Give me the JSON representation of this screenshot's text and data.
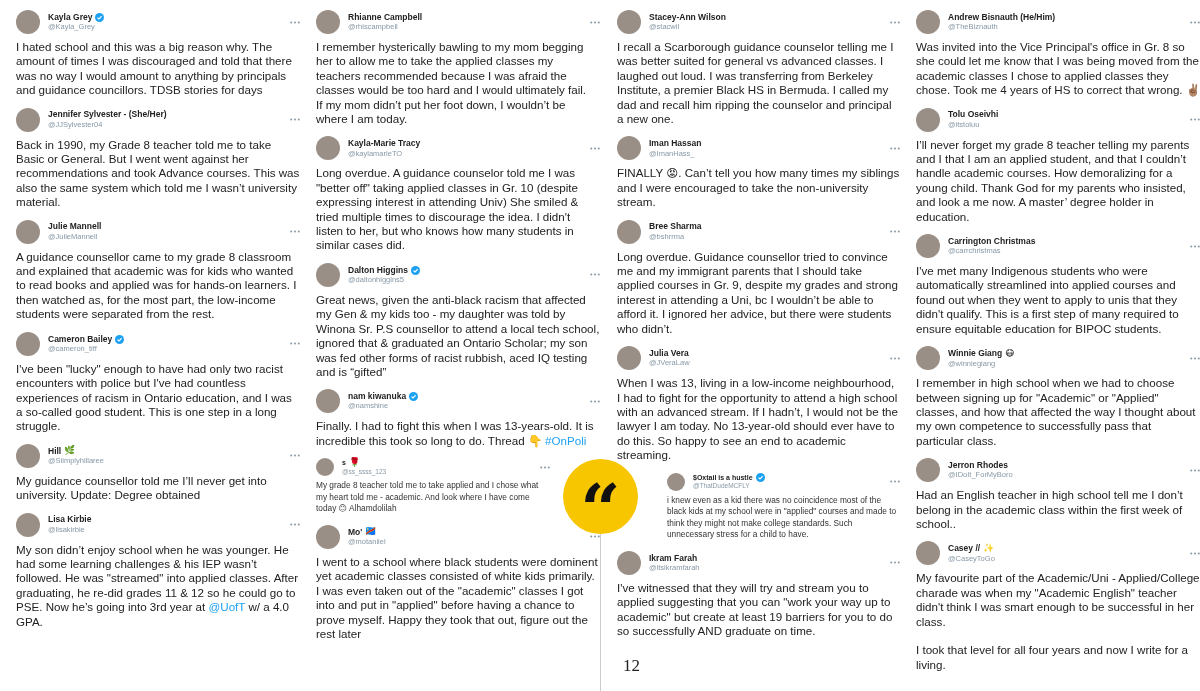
{
  "columns": [
    {
      "tweets": [
        {
          "name": "Kayla Grey",
          "verified": true,
          "handle": "@Kayla_Grey",
          "compact": false,
          "body": [
            {
              "kind": "text",
              "text": "I hated school and this was a big reason why. The amount of times I was  discouraged and told that there was no way I would amount to anything by principals and guidance councillors. TDSB stories for days"
            }
          ]
        },
        {
          "name": "Jennifer Sylvester - (She/Her)",
          "verified": false,
          "handle": "@JJSylvester04",
          "compact": false,
          "body": [
            {
              "kind": "text",
              "text": "Back in 1990, my Grade 8 teacher told me to take Basic or General. But I went went against her recommendations and took Advance courses. This was also the same system which told me I wasn’t university material."
            }
          ]
        },
        {
          "name": "Julie Mannell",
          "verified": false,
          "handle": "@JulieMannell",
          "compact": false,
          "body": [
            {
              "kind": "text",
              "text": "A guidance counsellor came to my grade 8 classroom and explained that academic was for kids who wanted to read books and applied was for hands-on learners. I then watched as, for the most part, the low-income students were separated from the rest."
            }
          ]
        },
        {
          "name": "Cameron Bailey",
          "verified": true,
          "handle": "@cameron_tiff",
          "compact": false,
          "body": [
            {
              "kind": "text",
              "text": "I've been \"lucky\" enough to have had only two racist encounters with police but I've had countless experiences of racism in Ontario education, and I was a so-called good student. This is one step in a long struggle."
            }
          ]
        },
        {
          "name": "Hill",
          "name_emoji": "🌿",
          "verified": false,
          "handle": "@Siimplyhillaree",
          "compact": false,
          "body": [
            {
              "kind": "text",
              "text": "My guidance counsellor told me I’ll never get into university. Update: Degree obtained"
            }
          ]
        },
        {
          "name": "Lisa Kirbie",
          "verified": false,
          "handle": "@lisakirbie",
          "compact": false,
          "body": [
            {
              "kind": "text",
              "text": "My son didn’t enjoy school when he was younger. He had some learning challenges & his IEP wasn’t followed. He was \"streamed\" into applied classes. After graduating, he re-did grades 11 & 12 so he could go to PSE. Now he’s going into 3rd year at "
            },
            {
              "kind": "link",
              "text": "@UofT"
            },
            {
              "kind": "text",
              "text": " w/ a 4.0 GPA."
            }
          ]
        }
      ]
    },
    {
      "tweets": [
        {
          "name": "Rhianne Campbell",
          "verified": false,
          "handle": "@rhiscampbell",
          "compact": false,
          "body": [
            {
              "kind": "text",
              "text": "I remember hysterically bawling to my mom begging her to allow me to take the applied classes my teachers recommended because I was afraid the classes would be too hard and I would ultimately fail.\nIf my mom didn’t put her foot down, I wouldn’t be where I am today."
            }
          ]
        },
        {
          "name": "Kayla-Marie Tracy",
          "verified": false,
          "handle": "@kaylamarieTO",
          "compact": false,
          "body": [
            {
              "kind": "text",
              "text": "Long overdue. A guidance counselor told me I was \"better off\" taking applied classes in Gr. 10 (despite expressing interest in attending Univ) She smiled & tried multiple times to discourage the idea. I didn't listen to her, but who knows how many students in similar cases did."
            }
          ]
        },
        {
          "name": "Dalton Higgins",
          "verified": true,
          "handle": "@daltonhiggins5",
          "compact": false,
          "body": [
            {
              "kind": "text",
              "text": "Great news, given the anti-black racism that affected my Gen & my kids too - my daughter was told by Winona Sr. P.S counsellor to attend a local tech school, ignored that & graduated an Ontario Scholar; my son was fed other forms of racist rubbish, aced IQ testing and is “gifted”"
            }
          ]
        },
        {
          "name": "nam kiwanuka",
          "verified": true,
          "handle": "@namshine",
          "compact": false,
          "body": [
            {
              "kind": "text",
              "text": "Finally. I had to fight this when I was 13-years-old. It is incredible this took so long to do. Thread 👇 "
            },
            {
              "kind": "link",
              "text": "#OnPoli"
            }
          ]
        },
        {
          "name": "s",
          "name_emoji": "🌹",
          "verified": false,
          "handle": "@ss_ssss_123",
          "compact": true,
          "body": [
            {
              "kind": "text",
              "text": "My grade 8 teacher told me to take applied and I chose what my heart told me - academic. And look where I have come today 😊 Alhamdolilah"
            }
          ]
        },
        {
          "name": "Mo'",
          "name_emoji": "🇨🇩",
          "verified": false,
          "handle": "@motaniiel",
          "compact": false,
          "body": [
            {
              "kind": "text",
              "text": "I went to a school where black students were dominent yet academic classes consisted of white kids primarily. I was even taken out of the \"academic\" classes I got into and put in \"applied\" before having a chance to prove myself. Happy they took that out, figure out the rest later"
            }
          ]
        }
      ]
    },
    {
      "tweets": [
        {
          "name": "Stacey-Ann Wilson",
          "verified": false,
          "handle": "@stacwil",
          "compact": false,
          "body": [
            {
              "kind": "text",
              "text": "I recall a Scarborough guidance counselor telling me I was better suited for general vs advanced classes. I laughed out loud. I was transferring from Berkeley Institute, a premier Black HS in Bermuda. I called my dad and recall him ripping the counselor and principal a new one."
            }
          ]
        },
        {
          "name": "Iman Hassan",
          "verified": false,
          "handle": "@ImanHass_",
          "compact": false,
          "body": [
            {
              "kind": "text",
              "text": "FINALLY 😡. Can’t tell you how many times my siblings and I were encouraged to take the non-university stream."
            }
          ]
        },
        {
          "name": "Bree Sharma",
          "verified": false,
          "handle": "@bshrrma",
          "compact": false,
          "body": [
            {
              "kind": "text",
              "text": "Long overdue. Guidance counsellor tried to convince me and my immigrant parents that I should take applied courses in Gr. 9, despite my grades and strong interest in attending a Uni, bc I wouldn’t be able to afford it. I ignored her advice, but there were students who didn’t."
            }
          ]
        },
        {
          "name": "Julia Vera",
          "verified": false,
          "handle": "@JVeraLaw",
          "compact": false,
          "body": [
            {
              "kind": "text",
              "text": "When I was 13, living in a low-income neighbourhood, I had to fight for the opportunity to attend a high school with an advanced stream. If I hadn’t, I would not be the lawyer I am today. No 13-year-old should ever have to do this. So happy to see an end to academic streaming."
            }
          ]
        },
        {
          "name": "$Oxtail is a hustle",
          "verified": true,
          "handle": "@ThatDudeMCFLY",
          "compact": true,
          "body": [
            {
              "kind": "text",
              "text": "i knew even as a kid there was no coincidence most of the black kids at my school were in \"applied\" courses and made to think they might not make college standards. Such unnecessary stress for a child to have."
            }
          ]
        },
        {
          "name": "Ikram Farah",
          "verified": false,
          "handle": "@itsikramfarah",
          "compact": false,
          "body": [
            {
              "kind": "text",
              "text": "I've witnessed that they will try and stream you to applied suggesting that you can \"work your way up to academic\" but create at least 19 barriers for you to do so successfully AND graduate on time."
            }
          ]
        }
      ]
    },
    {
      "tweets": [
        {
          "name": "Andrew Bisnauth (He/Him)",
          "verified": false,
          "handle": "@TheBiznauth",
          "compact": false,
          "body": [
            {
              "kind": "text",
              "text": "Was invited into the Vice Principal's office in Gr. 8 so she could let me know that I was being moved from the academic classes I chose to applied classes they chose. Took me 4 years of HS to correct that wrong. ✌🏽"
            }
          ]
        },
        {
          "name": "Tolu Oseivhi",
          "verified": false,
          "handle": "@itstoluu",
          "compact": false,
          "body": [
            {
              "kind": "text",
              "text": "I’ll never forget my grade 8 teacher telling my parents and I that I am an applied student, and that I couldn’t handle academic courses. How demoralizing for a young child. Thank God for my parents who insisted, and look a me now. A master’ degree holder in education."
            }
          ]
        },
        {
          "name": "Carrington Christmas",
          "verified": false,
          "handle": "@carrchristmas",
          "compact": false,
          "body": [
            {
              "kind": "text",
              "text": "I've met many Indigenous students who were automatically streamlined into applied courses and found out when they went to apply to unis that they didn't qualify. This is a first step of many required to ensure equitable education for BIPOC students."
            }
          ]
        },
        {
          "name": "Winnie Giang",
          "name_emoji": "😷",
          "verified": false,
          "handle": "@winniegiang",
          "compact": false,
          "body": [
            {
              "kind": "text",
              "text": "I remember in high school when we had to choose between signing up for \"Academic\" or \"Applied\" classes, and how that affected the way I thought about my own competence to successfully pass that particular class."
            }
          ]
        },
        {
          "name": "Jerron Rhodes",
          "verified": false,
          "handle": "@IDoIt_ForMyBoro",
          "compact": false,
          "body": [
            {
              "kind": "text",
              "text": "Had an English teacher in high school tell me I don’t belong in the academic class within the first week of school.."
            }
          ]
        },
        {
          "name": "Casey //",
          "name_emoji": "✨",
          "verified": false,
          "handle": "@CaseyToGo",
          "compact": false,
          "body": [
            {
              "kind": "text",
              "text": "My favourite part of the Academic/Uni - Applied/College charade was when my \"Academic English\" teacher didn't think I was smart enough to be successful in her class.\n\nI took that level for all four years and now I write for a living."
            }
          ]
        }
      ]
    }
  ],
  "quote_mark": "“",
  "page_number": "12"
}
